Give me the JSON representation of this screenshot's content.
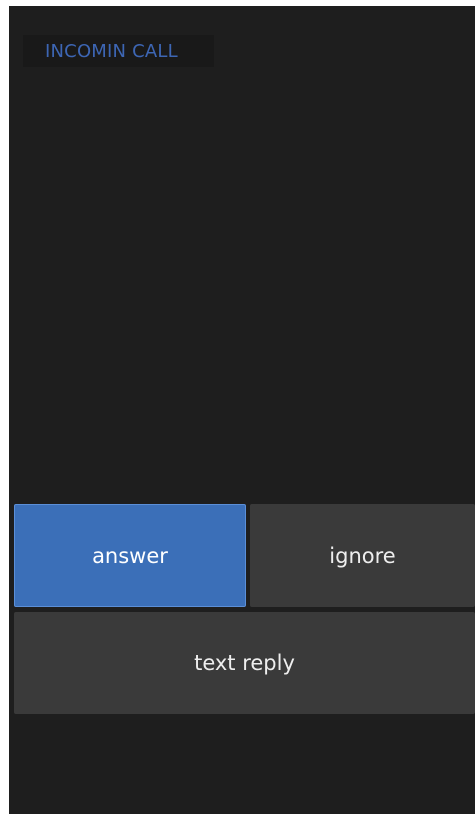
{
  "header": {
    "title": "INCOMIN CALL"
  },
  "actions": {
    "answer_label": "answer",
    "ignore_label": "ignore",
    "text_reply_label": "text reply"
  },
  "colors": {
    "background": "#1e1e1e",
    "accent": "#3b6fb8",
    "title_text": "#3d66b4",
    "secondary_button": "#3a3a3a"
  }
}
